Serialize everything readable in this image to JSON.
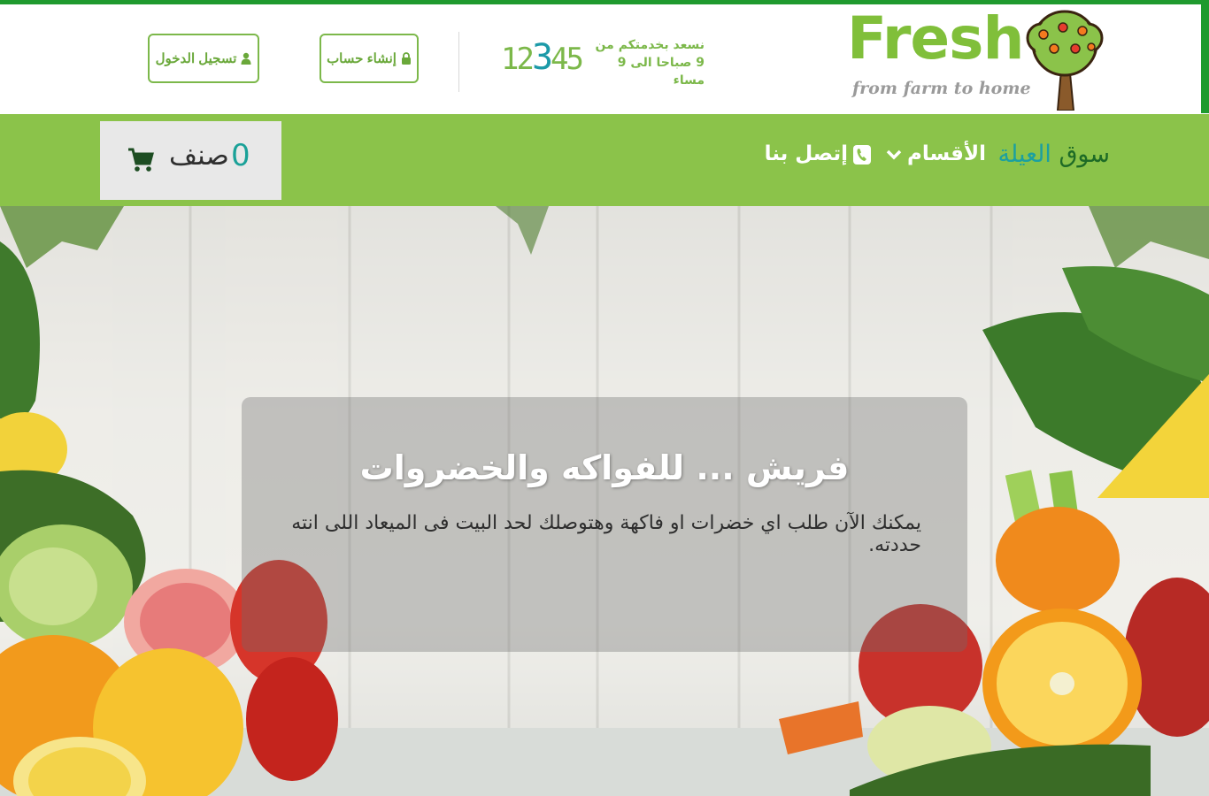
{
  "brand": {
    "name": "Fresh",
    "tagline": "from farm to home",
    "colors": {
      "green": "#8bc34a",
      "dark_green": "#1f9a2e",
      "teal": "#1ba0a0"
    }
  },
  "topbar": {
    "hours_line1": "نسعد بخدمتكم من",
    "hours_line2": "9 صباحا الى 9 مساء",
    "hotline_pre": "12",
    "hotline_accent": "3",
    "hotline_post": "45",
    "signup_label": "إنشاء حساب",
    "login_label": "تسجيل الدخول"
  },
  "nav": {
    "brand_part1": "سوق",
    "brand_part2": "العيلة",
    "sections_label": "الأقسام",
    "contact_label": "إتصل بنا"
  },
  "cart": {
    "count": "0",
    "unit_label": "صنف"
  },
  "hero": {
    "title": "فريش ... للفواكه والخضروات",
    "subtitle": "يمكنك الآن طلب اي خضرات او فاكهة وهتوصلك لحد البيت فى الميعاد اللى انته حددته."
  },
  "icons": {
    "login": "user-icon",
    "signup": "lock-icon",
    "sections": "chevron-down-icon",
    "contact": "phone-icon",
    "cart": "shopping-cart-icon"
  }
}
